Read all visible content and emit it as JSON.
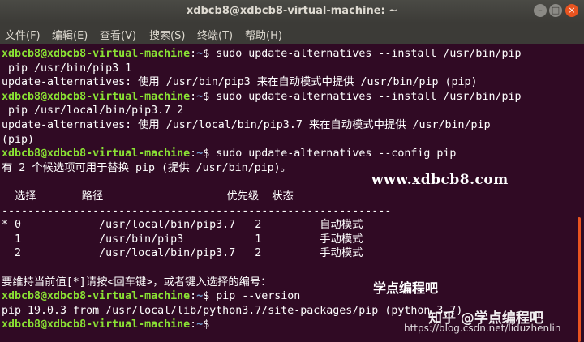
{
  "window": {
    "title": "xdbcb8@xdbcb8-virtual-machine: ~",
    "buttons": {
      "minimize_glyph": "–",
      "maximize_glyph": "□",
      "close_glyph": "×"
    }
  },
  "menubar": {
    "items": [
      "文件(F)",
      "编辑(E)",
      "查看(V)",
      "搜索(S)",
      "终端(T)",
      "帮助(H)"
    ]
  },
  "terminal": {
    "prompt_user_host": "xdbcb8@xdbcb8-virtual-machine",
    "lines": [
      {
        "type": "prompt",
        "path": "~",
        "cmd": "sudo update-alternatives --install /usr/bin/pip"
      },
      {
        "type": "text",
        "text": " pip /usr/bin/pip3 1"
      },
      {
        "type": "text",
        "text": "update-alternatives: 使用 /usr/bin/pip3 来在自动模式中提供 /usr/bin/pip (pip)"
      },
      {
        "type": "prompt",
        "path": "~",
        "cmd": "sudo update-alternatives --install /usr/bin/pip"
      },
      {
        "type": "text",
        "text": " pip /usr/local/bin/pip3.7 2"
      },
      {
        "type": "text",
        "text": "update-alternatives: 使用 /usr/local/bin/pip3.7 来在自动模式中提供 /usr/bin/pip"
      },
      {
        "type": "text",
        "text": "(pip)"
      },
      {
        "type": "prompt",
        "path": "~",
        "cmd": "sudo update-alternatives --config pip"
      },
      {
        "type": "text",
        "text": "有 2 个候选项可用于替换 pip (提供 /usr/bin/pip)。"
      },
      {
        "type": "text",
        "text": ""
      },
      {
        "type": "text",
        "text": "  选择       路径                   优先级  状态"
      },
      {
        "type": "text",
        "text": "------------------------------------------------------------"
      },
      {
        "type": "text",
        "text": "* 0            /usr/local/bin/pip3.7   2         自动模式"
      },
      {
        "type": "text",
        "text": "  1            /usr/bin/pip3           1         手动模式"
      },
      {
        "type": "text",
        "text": "  2            /usr/local/bin/pip3.7   2         手动模式"
      },
      {
        "type": "text",
        "text": ""
      },
      {
        "type": "text",
        "text": "要维持当前值[*]请按<回车键>，或者键入选择的编号："
      },
      {
        "type": "prompt",
        "path": "~",
        "cmd": "pip --version"
      },
      {
        "type": "text",
        "text": "pip 19.0.3 from /usr/local/lib/python3.7/site-packages/pip (python 3.7)"
      },
      {
        "type": "prompt",
        "path": "~",
        "cmd": ""
      }
    ]
  },
  "watermarks": {
    "site": "www.xdbcb8.com",
    "channel": "学点编程吧",
    "zhihu": "知乎 @学点编程吧",
    "csdn": "https://blog.csdn.net/liduzhenlin"
  },
  "colors": {
    "background": "#300a24",
    "prompt_user": "#8ae234",
    "prompt_path": "#729fcf",
    "text": "#ffffff",
    "titlebar": "#3c3b37",
    "close_button": "#e95420",
    "scrollbar": "#e95420"
  }
}
